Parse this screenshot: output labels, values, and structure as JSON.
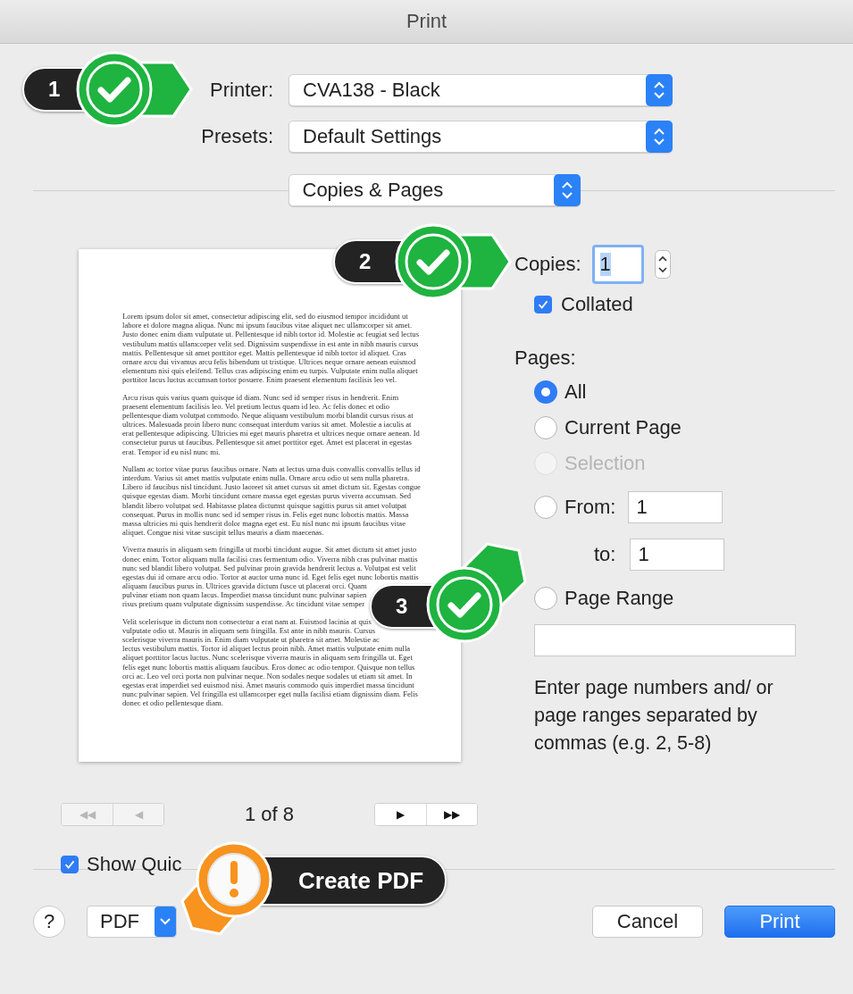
{
  "window": {
    "title": "Print"
  },
  "printer": {
    "label": "Printer:",
    "value": "CVA138 - Black"
  },
  "presets": {
    "label": "Presets:",
    "value": "Default Settings"
  },
  "section_menu": {
    "value": "Copies & Pages"
  },
  "preview": {
    "paragraphs": [
      [
        "Lorem ipsum dolor sit amet, consectetur adipiscing elit, sed do eiusmod tempor incididunt ut",
        "labore et dolore magna aliqua. Nunc mi ipsum faucibus vitae aliquet nec ullamcorper sit amet.",
        "Justo donec enim diam vulputate ut. Pellentesque id nibh tortor id. Molestie ac feugiat sed lectus",
        "vestibulum mattis ullamcorper velit sed. Dignissim suspendisse in est ante in nibh mauris cursus",
        "mattis. Pellentesque sit amet porttitor eget. Mattis pellentesque id nibh tortor id aliquet. Cras",
        "ornare arcu dui vivamus arcu felis bibendum ut tristique. Ultrices neque ornare aenean euismod",
        "elementum nisi quis eleifend. Tellus cras adipiscing enim eu turpis. Vulputate enim nulla aliquet",
        "porttitor lacus luctus accumsan tortor posuere. Enim praesent elementum facilisis leo vel."
      ],
      [
        "Arcu risus quis varius quam quisque id diam. Nunc sed id semper risus in hendrerit. Enim",
        "praesent elementum facilisis leo. Vel pretium lectus quam id leo. Ac felis donec et odio",
        "pellentesque diam volutpat commodo. Neque aliquam vestibulum morbi blandit cursus risus at",
        "ultrices. Malesuada proin libero nunc consequat interdum varius sit amet. Molestie a iaculis at",
        "erat pellentesque adipiscing. Ultricies mi eget mauris pharetra et ultrices neque ornare aenean. Id",
        "consectetur purus ut faucibus. Pellentesque sit amet porttitor eget. Amet est placerat in egestas",
        "erat. Tempor id eu nisl nunc mi."
      ],
      [
        "Nullam ac tortor vitae purus faucibus ornare. Nam at lectus urna duis convallis convallis tellus id",
        "interdum. Varius sit amet mattis vulputate enim nulla. Ornare arcu odio ut sem nulla pharetra.",
        "Libero id faucibus nisl tincidunt. Justo laoreet sit amet cursus sit amet dictum sit. Egestas congue",
        "quisque egestas diam. Morbi tincidunt ornare massa eget egestas purus viverra accumsan. Sed",
        "blandit libero volutpat sed. Habitasse platea dictumst quisque sagittis purus sit amet volutpat",
        "consequat. Purus in mollis nunc sed id semper risus in. Felis eget nunc lobortis mattis. Massa",
        "massa ultricies mi quis hendrerit dolor magna eget est. Eu nisl nunc mi ipsum faucibus vitae",
        "aliquet. Congue nisi vitae suscipit tellus mauris a diam maecenas."
      ],
      [
        "Viverra mauris in aliquam sem fringilla ut morbi tincidunt augue. Sit amet dictum sit amet justo",
        "donec enim. Tortor aliquam nulla facilisi cras fermentum odio. Viverra nibh cras pulvinar mattis",
        "nunc sed blandit libero volutpat. Sed pulvinar proin gravida hendrerit lectus a. Volutpat est velit",
        "egestas dui id ornare arcu odio. Tortor at auctor urna nunc id. Eget felis eget nunc lobortis mattis",
        "aliquam faucibus purus in. Ultrices gravida dictum fusce ut placerat orci. Quam",
        "pulvinar etiam non quam lacus. Imperdiet massa tincidunt nunc pulvinar sapien",
        "risus pretium quam vulputate dignissim suspendisse. Ac tincidunt vitae semper"
      ],
      [
        "Velit scelerisque in dictum non consectetur a erat nam at. Euismod lacinia at quis",
        "vulputate odio ut. Mauris in aliquam sem fringilla. Est ante in nibh mauris. Cursus",
        "scelerisque viverra mauris in. Enim diam vulputate ut pharetra sit amet. Molestie ac",
        "lectus vestibulum mattis. Tortor id aliquet lectus proin nibh. Amet mattis vulputate enim nulla",
        "aliquet porttitor lacus luctus. Nunc scelerisque viverra mauris in aliquam sem fringilla ut. Eget",
        "felis eget nunc lobortis mattis aliquam faucibus. Eros donec ac odio tempor. Quisque non tellus",
        "orci ac. Leo vel orci porta non pulvinar neque. Non sodales neque sodales ut etiam sit amet. In",
        "egestas erat imperdiet sed euismod nisi. Amet mauris commodo quis imperdiet massa tincidunt",
        "nunc pulvinar sapien. Vel fringilla est ullamcorper eget nulla facilisi etiam dignissim diam. Felis",
        "donec et odio pellentesque diam."
      ]
    ]
  },
  "pager": {
    "text": "1 of 8",
    "back": [
      {
        "glyph": "◀◀",
        "disabled": true
      },
      {
        "glyph": "◀",
        "disabled": true
      }
    ],
    "forward": [
      {
        "glyph": "▶",
        "disabled": false
      },
      {
        "glyph": "▶▶",
        "disabled": false
      }
    ]
  },
  "show_quick": {
    "label": "Show Quic",
    "checked": true
  },
  "copies": {
    "label": "Copies:",
    "value": "1"
  },
  "collated": {
    "label": "Collated",
    "checked": true
  },
  "pages": {
    "label": "Pages:",
    "options": [
      {
        "kind": "plain",
        "label": "All",
        "selected": true,
        "disabled": false
      },
      {
        "kind": "plain",
        "label": "Current Page",
        "selected": false,
        "disabled": false
      },
      {
        "kind": "plain",
        "label": "Selection",
        "selected": false,
        "disabled": true
      },
      {
        "kind": "from_to",
        "label": "From:",
        "selected": false,
        "disabled": false,
        "from_value": "1",
        "to_label": "to:",
        "to_value": "1"
      },
      {
        "kind": "range",
        "label": "Page Range",
        "selected": false,
        "disabled": false
      }
    ],
    "hint": "Enter page numbers and/ or page ranges separated by commas (e.g. 2, 5-8)"
  },
  "footer": {
    "help": "?",
    "pdf": "PDF",
    "buttons": [
      {
        "label": "Cancel",
        "default": false
      },
      {
        "label": "Print",
        "default": true
      }
    ]
  },
  "callouts": [
    {
      "kind": "check",
      "number": "1"
    },
    {
      "kind": "check",
      "number": "2"
    },
    {
      "kind": "check",
      "number": "3"
    },
    {
      "kind": "warning",
      "label": "Create PDF"
    }
  ]
}
